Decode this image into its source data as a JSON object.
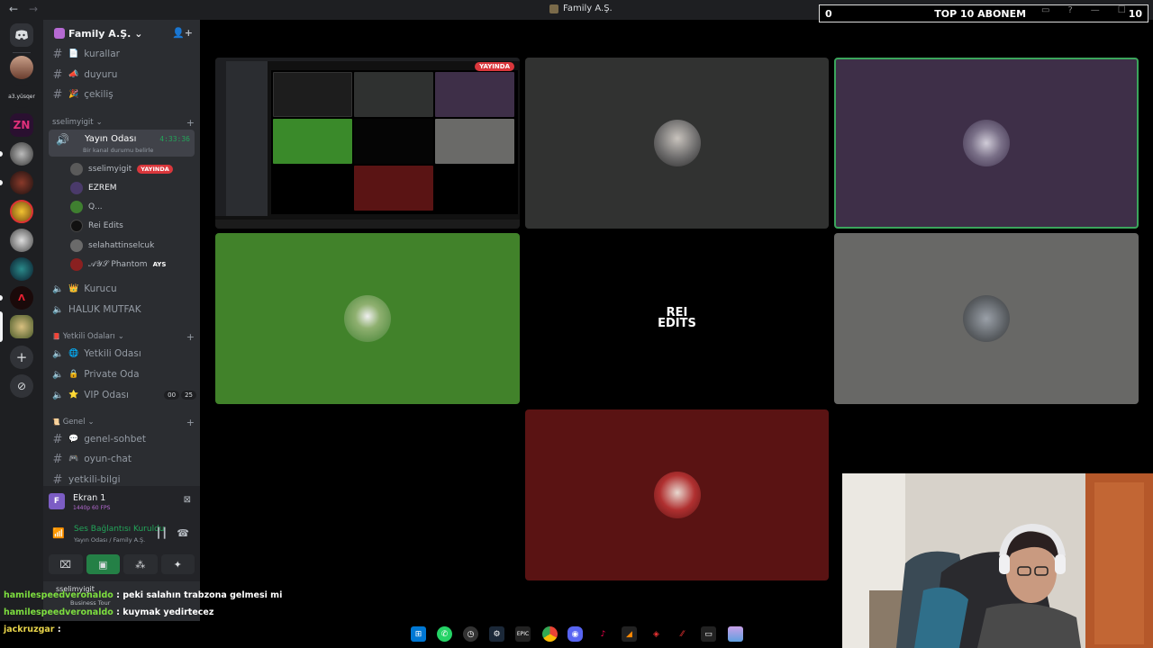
{
  "window": {
    "title": "Family A.Ş.",
    "back_icon": "←",
    "forward_icon": "→",
    "controls": [
      "▭",
      "?",
      "—",
      "☐",
      "✕"
    ]
  },
  "overlay": {
    "left_count": "0",
    "title": "TOP 10 ABONEM",
    "right_count": "10"
  },
  "server": {
    "name": "Family A.Ş.",
    "chevron": "⌄"
  },
  "channels_top": [
    {
      "name": "kurallar",
      "emoji": "📄"
    },
    {
      "name": "duyuru",
      "emoji": "📣"
    },
    {
      "name": "çekiliş",
      "emoji": "🎉"
    }
  ],
  "categories": {
    "sselimyigit": "sselimyigit",
    "yetkili": "Yetkili Odaları",
    "genel": "Genel"
  },
  "voice_active": {
    "name": "Yayın Odası",
    "timer": "4:33:36",
    "status": "Bir kanal durumu belirle"
  },
  "voice_users": [
    {
      "name": "sselimyigit",
      "badge": "YAYINDA",
      "color": "#5a5a5a"
    },
    {
      "name": "EZREM",
      "badge": "",
      "color": "#4a3a6a"
    },
    {
      "name": "Q...",
      "badge": "",
      "color": "#3f7f30"
    },
    {
      "name": "Rei Edits",
      "badge": "",
      "color": "#111111"
    },
    {
      "name": "selahattinselcuk",
      "badge": "",
      "color": "#6a6a6a"
    },
    {
      "name": "𝒜𝒴𝒮 Phantom",
      "badge": "AYS",
      "color": "#8a2020"
    }
  ],
  "voice_rooms": [
    {
      "name": "Kurucu",
      "emoji": "👑"
    },
    {
      "name": "HALUK MUTFAK",
      "emoji": ""
    }
  ],
  "yetkili_rooms": [
    {
      "name": "Yetkili Odası",
      "emoji": "🌐"
    },
    {
      "name": "Private Oda",
      "emoji": "🔒"
    },
    {
      "name": "VIP Odası",
      "emoji": "⭐",
      "count_a": "00",
      "count_b": "25"
    }
  ],
  "genel_channels": [
    {
      "name": "genel-sohbet",
      "emoji": "💬"
    },
    {
      "name": "oyun-chat",
      "emoji": "🎮"
    },
    {
      "name": "yetkili-bilgi",
      "emoji": ""
    }
  ],
  "stream_panel": {
    "initial": "F",
    "title": "Ekran 1",
    "quality": "1440p 60 FPS"
  },
  "connection": {
    "status": "Ses Bağlantısı Kuruldu",
    "location": "Yayın Odası / Family A.Ş."
  },
  "user": {
    "name": "sselimyigit",
    "activity": "Business Tour"
  },
  "stage": {
    "live_badge": "YAYINDA",
    "rei_line1": "REI",
    "rei_line2": "EDITS"
  },
  "chat": [
    {
      "user": "hamilespeedveronaldo",
      "message": ": peki salahın trabzona gelmesi mi"
    },
    {
      "user": "hamilespeedveronaldo",
      "message": ": kuymak yedirtecez"
    },
    {
      "user": "jackruzgar",
      "message": ":"
    }
  ],
  "colors": {
    "discord_bg": "#2b2d31",
    "rail_bg": "#1e1f22",
    "green": "#23a55a",
    "live_red": "#da373c"
  }
}
